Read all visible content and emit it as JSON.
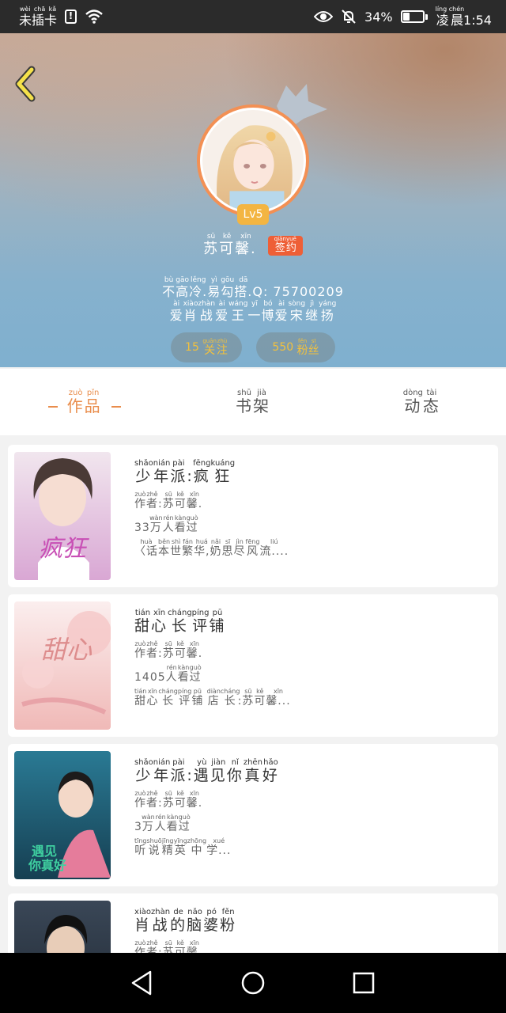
{
  "status_bar": {
    "sim": "未插卡",
    "sim_pinyin": "wèi chā kǎ",
    "battery_percent": "34%",
    "battery_level": 0.34,
    "time_period": "凌晨",
    "time_period_pinyin": "líng chén",
    "time": "1:54"
  },
  "profile": {
    "level": "Lv5",
    "name": "苏可馨.",
    "name_chars": [
      [
        "苏",
        "sū"
      ],
      [
        "可",
        "kě"
      ],
      [
        "馨.",
        "xīn"
      ]
    ],
    "sign_badge": [
      [
        "签",
        "qiān"
      ],
      [
        "约",
        "yuē"
      ]
    ],
    "bio_line1": [
      [
        "不",
        "bù"
      ],
      [
        "高",
        "gāo"
      ],
      [
        "冷.",
        "lěng"
      ],
      [
        "易",
        "yì"
      ],
      [
        "勾",
        "gōu"
      ],
      [
        "搭.",
        "dā"
      ]
    ],
    "bio_line1_suffix": "Q: 75700209",
    "bio_line2": [
      [
        "爱",
        "ài"
      ],
      [
        "肖",
        "xiào"
      ],
      [
        "战",
        "zhàn"
      ],
      [
        "爱",
        "ài"
      ],
      [
        "王",
        "wáng"
      ],
      [
        "一",
        "yī"
      ],
      [
        "博",
        "bó"
      ],
      [
        "爱",
        "ài"
      ],
      [
        "宋",
        "sòng"
      ],
      [
        "继",
        "jì"
      ],
      [
        "扬",
        "yáng"
      ]
    ],
    "following_count": "15",
    "following_label": [
      [
        "关",
        "guān"
      ],
      [
        "注",
        "zhù"
      ]
    ],
    "followers_count": "550",
    "followers_label": [
      [
        "粉",
        "fěn"
      ],
      [
        "丝",
        "sī"
      ]
    ]
  },
  "tabs": [
    {
      "chars": [
        [
          "作",
          "zuò"
        ],
        [
          "品",
          "pǐn"
        ]
      ],
      "active": true
    },
    {
      "chars": [
        [
          "书",
          "shū"
        ],
        [
          "架",
          "jià"
        ]
      ],
      "active": false
    },
    {
      "chars": [
        [
          "动",
          "dòng"
        ],
        [
          "态",
          "tài"
        ]
      ],
      "active": false
    }
  ],
  "books": [
    {
      "title": [
        [
          "少",
          "shǎo"
        ],
        [
          "年",
          "nián"
        ],
        [
          "派",
          "pài"
        ],
        [
          ":",
          ""
        ],
        [
          "疯",
          "fēng"
        ],
        [
          "狂",
          "kuáng"
        ]
      ],
      "author": [
        [
          "作",
          "zuò"
        ],
        [
          "者",
          "zhě"
        ],
        [
          ":",
          ""
        ],
        [
          "苏",
          "sū"
        ],
        [
          "可",
          "kě"
        ],
        [
          "馨.",
          "xīn"
        ]
      ],
      "views_num": "33",
      "views": [
        [
          "万",
          "wàn"
        ],
        [
          "人",
          "rén"
        ],
        [
          "看",
          "kàn"
        ],
        [
          "过",
          "guò"
        ]
      ],
      "desc": [
        [
          "〈话",
          "huà"
        ],
        [
          "本",
          "běn"
        ],
        [
          "世",
          "shì"
        ],
        [
          "繁",
          "fán"
        ],
        [
          "华,",
          "huá"
        ],
        [
          "奶",
          "nǎi"
        ],
        [
          "思",
          "sī"
        ],
        [
          "尽",
          "jìn"
        ],
        [
          "风",
          "fēng"
        ],
        [
          "流....",
          "liú"
        ]
      ],
      "cover_text": "疯狂",
      "cover_colors": [
        "#f1e6ee",
        "#d9a7d4"
      ]
    },
    {
      "title": [
        [
          "甜",
          "tián"
        ],
        [
          "心",
          "xīn"
        ],
        [
          "长",
          "cháng"
        ],
        [
          "评",
          "píng"
        ],
        [
          "铺",
          "pū"
        ]
      ],
      "author": [
        [
          "作",
          "zuò"
        ],
        [
          "者",
          "zhě"
        ],
        [
          ":",
          ""
        ],
        [
          "苏",
          "sū"
        ],
        [
          "可",
          "kě"
        ],
        [
          "馨.",
          "xīn"
        ]
      ],
      "views_num": "1405",
      "views": [
        [
          "人",
          "rén"
        ],
        [
          "看",
          "kàn"
        ],
        [
          "过",
          "guò"
        ]
      ],
      "desc": [
        [
          "甜",
          "tián"
        ],
        [
          "心",
          "xīn"
        ],
        [
          "长",
          "cháng"
        ],
        [
          "评",
          "píng"
        ],
        [
          "铺",
          "pū"
        ],
        [
          " ",
          ""
        ],
        [
          "店",
          "diàn"
        ],
        [
          "长",
          "cháng"
        ],
        [
          ":",
          ""
        ],
        [
          "苏",
          "sū"
        ],
        [
          "可",
          "kě"
        ],
        [
          "馨...",
          "xīn"
        ]
      ],
      "cover_text": "甜心",
      "cover_colors": [
        "#fbeeee",
        "#f0b9b7"
      ]
    },
    {
      "title": [
        [
          "少",
          "shǎo"
        ],
        [
          "年",
          "nián"
        ],
        [
          "派",
          "pài"
        ],
        [
          ":",
          ""
        ],
        [
          "遇",
          "yù"
        ],
        [
          "见",
          "jiàn"
        ],
        [
          "你",
          "nǐ"
        ],
        [
          "真",
          "zhēn"
        ],
        [
          "好",
          "hǎo"
        ]
      ],
      "author": [
        [
          "作",
          "zuò"
        ],
        [
          "者",
          "zhě"
        ],
        [
          ":",
          ""
        ],
        [
          "苏",
          "sū"
        ],
        [
          "可",
          "kě"
        ],
        [
          "馨.",
          "xīn"
        ]
      ],
      "views_num": "3",
      "views": [
        [
          "万",
          "wàn"
        ],
        [
          "人",
          "rén"
        ],
        [
          "看",
          "kàn"
        ],
        [
          "过",
          "guò"
        ]
      ],
      "desc": [
        [
          "听",
          "tīng"
        ],
        [
          "说",
          "shuō"
        ],
        [
          "精",
          "jīng"
        ],
        [
          "英",
          "yīng"
        ],
        [
          "中",
          "zhōng"
        ],
        [
          "学...",
          "xué"
        ]
      ],
      "cover_text": "遇见你真好",
      "cover_colors": [
        "#2a7a94",
        "#163f52"
      ]
    },
    {
      "title": [
        [
          "肖",
          "xiào"
        ],
        [
          "战",
          "zhàn"
        ],
        [
          "的",
          "de"
        ],
        [
          "脑",
          "nǎo"
        ],
        [
          "婆",
          "pó"
        ],
        [
          "粉",
          "fěn"
        ]
      ],
      "author": [
        [
          "作",
          "zuò"
        ],
        [
          "者",
          "zhě"
        ],
        [
          ":",
          ""
        ],
        [
          "苏",
          "sū"
        ],
        [
          "可",
          "kě"
        ],
        [
          "馨.",
          "xīn"
        ]
      ],
      "views_num": "",
      "views": [],
      "desc": [],
      "cover_text": "",
      "cover_colors": [
        "#3a4757",
        "#1e2630"
      ]
    }
  ],
  "icons": {
    "back": "chevron-left-icon",
    "crown": "crown-icon",
    "nav_back": "triangle-back-icon",
    "nav_home": "circle-home-icon",
    "nav_recent": "square-recent-icon"
  }
}
